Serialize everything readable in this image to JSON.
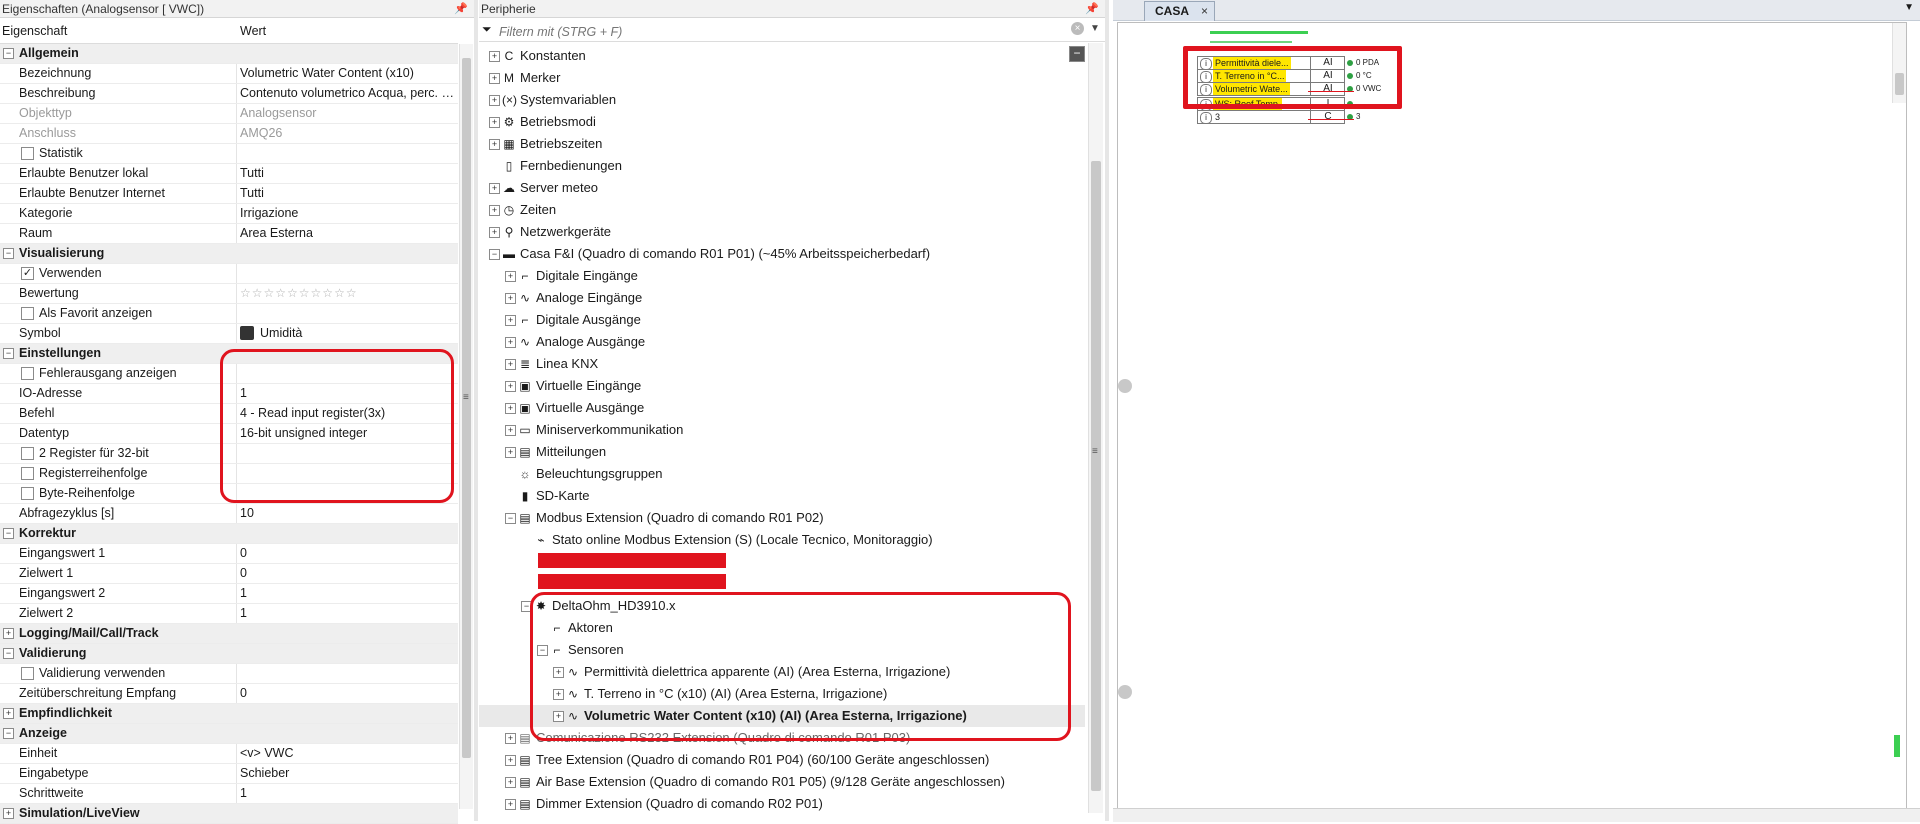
{
  "properties": {
    "header_title": "Eigenschaften (Analogsensor [ VWC])",
    "col_name": "Eigenschaft",
    "col_value": "Wert",
    "rows": [
      {
        "type": "cat",
        "name": "Allgemein"
      },
      {
        "type": "prop",
        "name": "Bezeichnung",
        "value": "Volumetric Water Content (x10)"
      },
      {
        "type": "prop",
        "name": "Beschreibung",
        "value": "Contenuto volumetrico Acqua, perc. (…"
      },
      {
        "type": "prop",
        "name": "Objekttyp",
        "value": "Analogsensor",
        "grey": true
      },
      {
        "type": "prop",
        "name": "Anschluss",
        "value": "AMQ26",
        "grey": true
      },
      {
        "type": "check",
        "name": "Statistik",
        "checked": false
      },
      {
        "type": "prop",
        "name": "Erlaubte Benutzer lokal",
        "value": "Tutti"
      },
      {
        "type": "prop",
        "name": "Erlaubte Benutzer Internet",
        "value": "Tutti"
      },
      {
        "type": "prop",
        "name": "Kategorie",
        "value": "Irrigazione"
      },
      {
        "type": "prop",
        "name": "Raum",
        "value": "Area Esterna"
      },
      {
        "type": "cat",
        "name": "Visualisierung"
      },
      {
        "type": "check",
        "name": "Verwenden",
        "checked": true
      },
      {
        "type": "stars",
        "name": "Bewertung",
        "value": "☆☆☆☆☆☆☆☆☆☆",
        "rating": 0
      },
      {
        "type": "check",
        "name": "Als Favorit anzeigen",
        "checked": false
      },
      {
        "type": "symbol",
        "name": "Symbol",
        "value": "Umidità",
        "icon": "humidity-symbol-icon"
      },
      {
        "type": "cat",
        "name": "Einstellungen"
      },
      {
        "type": "check",
        "name": "Fehlerausgang anzeigen",
        "checked": false
      },
      {
        "type": "prop",
        "name": "IO-Adresse",
        "value": "1"
      },
      {
        "type": "prop",
        "name": "Befehl",
        "value": "4 - Read input register(3x)"
      },
      {
        "type": "prop",
        "name": "Datentyp",
        "value": "16-bit unsigned integer"
      },
      {
        "type": "check",
        "name": "2 Register für 32-bit",
        "checked": false
      },
      {
        "type": "check",
        "name": "Registerreihenfolge",
        "checked": false
      },
      {
        "type": "check",
        "name": "Byte-Reihenfolge",
        "checked": false
      },
      {
        "type": "prop",
        "name": "Abfragezyklus [s]",
        "value": "10"
      },
      {
        "type": "cat",
        "name": "Korrektur"
      },
      {
        "type": "prop",
        "name": "Eingangswert 1",
        "value": "0"
      },
      {
        "type": "prop",
        "name": "Zielwert 1",
        "value": "0"
      },
      {
        "type": "prop",
        "name": "Eingangswert 2",
        "value": "1"
      },
      {
        "type": "prop",
        "name": "Zielwert 2",
        "value": "1"
      },
      {
        "type": "cat",
        "name": "Logging/Mail/Call/Track",
        "collapsed": true
      },
      {
        "type": "cat",
        "name": "Validierung"
      },
      {
        "type": "check",
        "name": "Validierung verwenden",
        "checked": false
      },
      {
        "type": "prop",
        "name": "Zeitüberschreitung Empfang",
        "value": "0"
      },
      {
        "type": "cat",
        "name": "Empfindlichkeit",
        "collapsed": true
      },
      {
        "type": "cat",
        "name": "Anzeige"
      },
      {
        "type": "prop",
        "name": "Einheit",
        "value": "<v> VWC"
      },
      {
        "type": "prop",
        "name": "Eingabetype",
        "value": "Schieber"
      },
      {
        "type": "prop",
        "name": "Schrittweite",
        "value": "1"
      },
      {
        "type": "cat",
        "name": "Simulation/LiveView",
        "collapsed": true
      }
    ]
  },
  "periphery": {
    "header_title": "Peripherie",
    "filter_placeholder": "Filtern mit (STRG + F)",
    "tree": [
      {
        "label": "Konstanten",
        "indent": 0,
        "exp": "+",
        "icon": "constant-icon",
        "glyph": "C"
      },
      {
        "label": "Merker",
        "indent": 0,
        "exp": "+",
        "icon": "marker-icon",
        "glyph": "M"
      },
      {
        "label": "Systemvariablen",
        "indent": 0,
        "exp": "+",
        "icon": "system-variable-icon",
        "glyph": "(×)"
      },
      {
        "label": "Betriebsmodi",
        "indent": 0,
        "exp": "+",
        "icon": "gear-icon",
        "glyph": "⚙"
      },
      {
        "label": "Betriebszeiten",
        "indent": 0,
        "exp": "+",
        "icon": "calendar-icon",
        "glyph": "▦"
      },
      {
        "label": "Fernbedienungen",
        "indent": 0,
        "exp": "",
        "icon": "remote-control-icon",
        "glyph": "▯"
      },
      {
        "label": "Server meteo",
        "indent": 0,
        "exp": "+",
        "icon": "weather-server-icon",
        "glyph": "☁"
      },
      {
        "label": "Zeiten",
        "indent": 0,
        "exp": "+",
        "icon": "clock-icon",
        "glyph": "◷"
      },
      {
        "label": "Netzwerkgeräte",
        "indent": 0,
        "exp": "+",
        "icon": "network-device-icon",
        "glyph": "⚲"
      },
      {
        "label": "Casa F&I (Quadro di comando R01 P01) (~45% Arbeitsspeicherbedarf)",
        "indent": 0,
        "exp": "−",
        "icon": "miniserver-icon",
        "glyph": "▬"
      },
      {
        "label": "Digitale Eingänge",
        "indent": 1,
        "exp": "+",
        "icon": "digital-input-icon",
        "glyph": "⌐"
      },
      {
        "label": "Analoge Eingänge",
        "indent": 1,
        "exp": "+",
        "icon": "analog-input-icon",
        "glyph": "∿"
      },
      {
        "label": "Digitale Ausgänge",
        "indent": 1,
        "exp": "+",
        "icon": "digital-output-icon",
        "glyph": "⌐"
      },
      {
        "label": "Analoge Ausgänge",
        "indent": 1,
        "exp": "+",
        "icon": "analog-output-icon",
        "glyph": "∿"
      },
      {
        "label": "Linea KNX",
        "indent": 1,
        "exp": "+",
        "icon": "knx-icon",
        "glyph": "≣"
      },
      {
        "label": "Virtuelle Eingänge",
        "indent": 1,
        "exp": "+",
        "icon": "virtual-input-icon",
        "glyph": "▣"
      },
      {
        "label": "Virtuelle Ausgänge",
        "indent": 1,
        "exp": "+",
        "icon": "virtual-output-icon",
        "glyph": "▣"
      },
      {
        "label": "Miniserverkommunikation",
        "indent": 1,
        "exp": "+",
        "icon": "miniserver-communication-icon",
        "glyph": "▭"
      },
      {
        "label": "Mitteilungen",
        "indent": 1,
        "exp": "+",
        "icon": "messages-icon",
        "glyph": "▤"
      },
      {
        "label": "Beleuchtungsgruppen",
        "indent": 1,
        "exp": "",
        "icon": "lighting-group-icon",
        "glyph": "☼"
      },
      {
        "label": "SD-Karte",
        "indent": 1,
        "exp": "",
        "icon": "sd-card-icon",
        "glyph": "▮"
      },
      {
        "label": "Modbus Extension (Quadro di comando R01 P02)",
        "indent": 1,
        "exp": "−",
        "icon": "extension-icon",
        "glyph": "▤"
      },
      {
        "label": "Stato online Modbus Extension (S) (Locale Tecnico, Monitoraggio)",
        "indent": 2,
        "exp": "",
        "icon": "status-icon",
        "glyph": "⌁"
      },
      {
        "label": "",
        "indent": 2,
        "exp": "",
        "icon": "",
        "glyph": "",
        "redacted": true
      },
      {
        "label": "",
        "indent": 2,
        "exp": "",
        "icon": "",
        "glyph": "",
        "redacted": true
      },
      {
        "label": "DeltaOhm_HD3910.x",
        "indent": 2,
        "exp": "−",
        "icon": "sensor-device-icon",
        "glyph": "✸"
      },
      {
        "label": "Aktoren",
        "indent": 3,
        "exp": "",
        "icon": "actuator-icon",
        "glyph": "⌐"
      },
      {
        "label": "Sensoren",
        "indent": 3,
        "exp": "−",
        "icon": "sensor-group-icon",
        "glyph": "⌐"
      },
      {
        "label": "Permittività dielettrica apparente (AI) (Area Esterna, Irrigazione)",
        "indent": 4,
        "exp": "+",
        "icon": "analog-sensor-icon",
        "glyph": "∿"
      },
      {
        "label": "T. Terreno in °C (x10) (AI) (Area Esterna, Irrigazione)",
        "indent": 4,
        "exp": "+",
        "icon": "analog-sensor-icon",
        "glyph": "∿"
      },
      {
        "label": "Volumetric Water Content (x10) (AI) (Area Esterna, Irrigazione)",
        "indent": 4,
        "exp": "+",
        "icon": "analog-sensor-icon",
        "glyph": "∿",
        "selected": true
      },
      {
        "label": "Comunicazione RS232 Extension (Quadro di comando R01 P03)",
        "indent": 1,
        "exp": "+",
        "icon": "extension-icon",
        "glyph": "▤",
        "obscured": true
      },
      {
        "label": "Tree Extension (Quadro di comando R01 P04) (60/100 Geräte angeschlossen)",
        "indent": 1,
        "exp": "+",
        "icon": "tree-extension-icon",
        "glyph": "▤"
      },
      {
        "label": "Air Base Extension (Quadro di comando R01 P05) (9/128 Geräte angeschlossen)",
        "indent": 1,
        "exp": "+",
        "icon": "air-extension-icon",
        "glyph": "▤"
      },
      {
        "label": "Dimmer Extension (Quadro di comando R02 P01)",
        "indent": 1,
        "exp": "+",
        "icon": "dimmer-extension-icon",
        "glyph": "▤"
      }
    ]
  },
  "casa": {
    "tab_label": "CASA",
    "tab_close": "×",
    "blocks": [
      {
        "tag": "i",
        "name": "Permittività diele...",
        "type": "AI",
        "out": "0 PDA"
      },
      {
        "tag": "i",
        "name": "T. Terreno in °C...",
        "type": "AI",
        "out": "0 °C"
      },
      {
        "tag": "i",
        "name": "Volumetric Wate...",
        "type": "AI",
        "out": "0 VWC"
      },
      {
        "tag": "i",
        "name": "WS: Roof Temp.",
        "type": "I",
        "out": ""
      },
      {
        "tag": "i",
        "name": "3",
        "type": "C",
        "out": "3"
      }
    ]
  },
  "colors": {
    "accent_red": "#e0141e",
    "block_yellow": "#ffe600",
    "status_green": "#2ea043"
  }
}
